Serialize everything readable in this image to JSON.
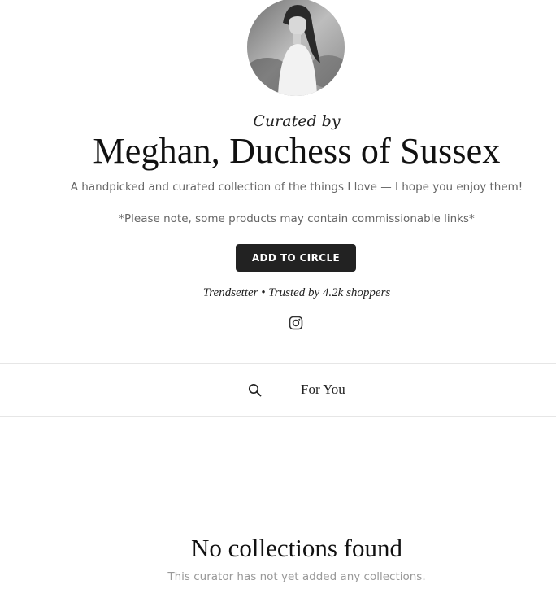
{
  "profile": {
    "curated_by": "Curated by",
    "name": "Meghan, Duchess of Sussex",
    "bio": "A handpicked and curated collection of the things I love — I hope you enjoy them!",
    "disclaimer": "*Please note, some products may contain commissionable links*",
    "add_button_label": "ADD TO CIRCLE",
    "trust_line": "Trendsetter • Trusted by 4.2k shoppers",
    "social_icon": "instagram-icon"
  },
  "nav": {
    "search_icon": "search-icon",
    "tabs": [
      {
        "label": "For You"
      }
    ]
  },
  "empty_state": {
    "title": "No collections found",
    "subtitle": "This curator has not yet added any collections."
  },
  "colors": {
    "button_bg": "#222222",
    "button_text": "#ffffff",
    "muted_text": "#666666",
    "faint_text": "#999999",
    "divider": "#e6e6e6"
  }
}
